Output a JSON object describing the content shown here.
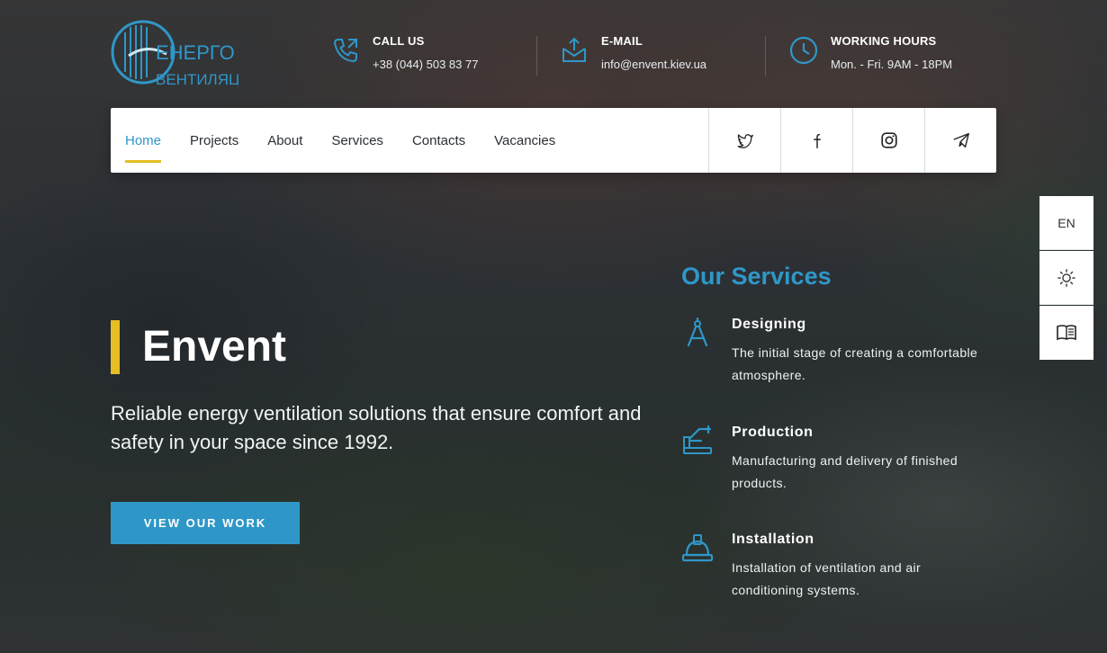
{
  "brand": {
    "logo_line1": "ЕНЕРГО",
    "logo_line2": "ВЕНТИЛЯЦІЯ",
    "accent": "#2f97c8",
    "highlight": "#e6be24"
  },
  "header": {
    "call": {
      "label": "CALL US",
      "value": "+38 (044) 503 83 77",
      "icon": "phone-icon"
    },
    "email": {
      "label": "E-MAIL",
      "value": "info@envent.kiev.ua",
      "icon": "mail-icon"
    },
    "hours": {
      "label": "WORKING HOURS",
      "value": "Mon. - Fri. 9AM - 18PM",
      "icon": "clock-icon"
    }
  },
  "nav": {
    "items": [
      {
        "label": "Home",
        "active": true
      },
      {
        "label": "Projects"
      },
      {
        "label": "About"
      },
      {
        "label": "Services"
      },
      {
        "label": "Contacts"
      },
      {
        "label": "Vacancies"
      }
    ],
    "social": [
      "twitter-icon",
      "facebook-icon",
      "instagram-icon",
      "telegram-icon"
    ]
  },
  "side": {
    "language": "EN",
    "theme_icon": "sun-icon",
    "reader_icon": "book-icon"
  },
  "hero": {
    "title": "Envent",
    "subtitle": "Reliable energy ventilation solutions that ensure comfort and safety in your space since 1992.",
    "cta": "VIEW OUR WORK"
  },
  "services": {
    "title": "Our Services",
    "items": [
      {
        "name": "Designing",
        "desc": "The initial stage of creating a comfortable atmosphere.",
        "icon": "compass-icon"
      },
      {
        "name": "Production",
        "desc": "Manufacturing and delivery of finished products.",
        "icon": "robot-arm-icon"
      },
      {
        "name": "Installation",
        "desc": "Installation of ventilation and air conditioning systems.",
        "icon": "hardhat-icon"
      }
    ]
  }
}
